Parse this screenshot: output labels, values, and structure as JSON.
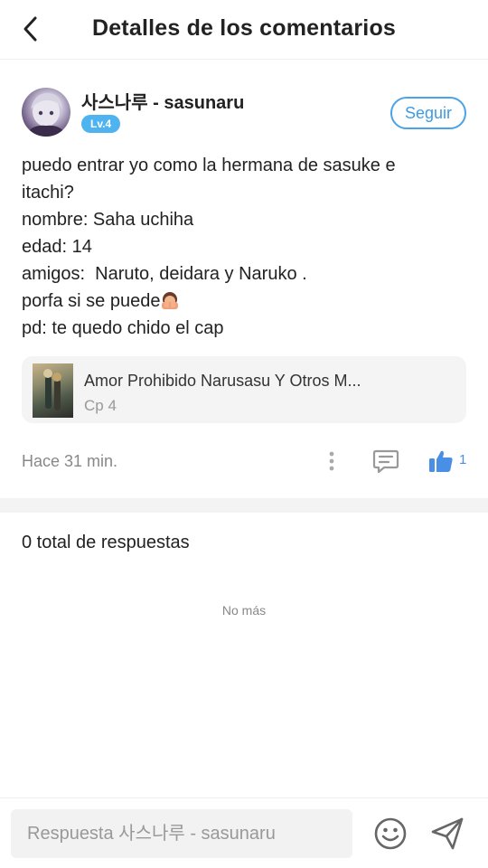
{
  "header": {
    "title": "Detalles de los comentarios",
    "back_icon": "chevron-left-icon"
  },
  "author": {
    "name": "사스나루 - sasunaru",
    "level": "Lv.4",
    "follow_label": "Seguir"
  },
  "comment": {
    "lines": [
      "puedo entrar yo como la hermana de sasuke e",
      "itachi?",
      "nombre: Saha uchiha",
      "edad: 14",
      "amigos:  Naruto, deidara y Naruko .",
      "porfa si se puede",
      "pd: te quedo chido el cap"
    ],
    "emoji_after_line_6": "face-with-hands-emoji"
  },
  "chapter": {
    "title": "Amor Prohibido Narusasu Y Otros M...",
    "subtitle": "Cp 4"
  },
  "meta": {
    "time_ago": "Hace 31 min.",
    "like_count": "1",
    "icons": [
      "more-vertical-icon",
      "reply-comment-icon",
      "thumbs-up-icon"
    ]
  },
  "replies": {
    "total_label": "0 total de respuestas",
    "no_more_label": "No más"
  },
  "reply_bar": {
    "placeholder": "Respuesta 사스나루 - sasunaru",
    "icons": [
      "emoji-smile-icon",
      "send-icon"
    ]
  },
  "colors": {
    "accent": "#4aa3e8",
    "badge": "#4fb3f0",
    "like": "#4a8fe6"
  }
}
